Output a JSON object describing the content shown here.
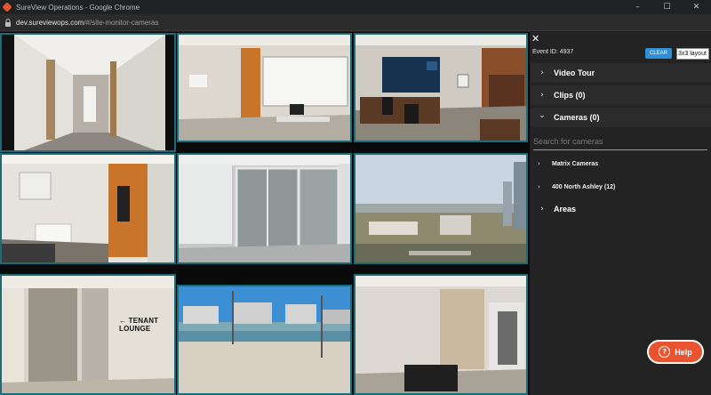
{
  "window": {
    "title": "SureView Operations - Google Chrome",
    "controls": {
      "minimize": "–",
      "maximize": "☐",
      "close": "✕"
    }
  },
  "address": {
    "host": "dev.sureviewops.com",
    "path": "/#/site-monitor-cameras",
    "lock_icon": "lock-icon"
  },
  "cameras": [
    {
      "id": "cam-1",
      "scene": "hallway"
    },
    {
      "id": "cam-2",
      "scene": "office-whiteboard"
    },
    {
      "id": "cam-3",
      "scene": "office-desks"
    },
    {
      "id": "cam-4",
      "scene": "room-with-printer"
    },
    {
      "id": "cam-5",
      "scene": "glass-doors"
    },
    {
      "id": "cam-6",
      "scene": "city-aerial"
    },
    {
      "id": "cam-7",
      "scene": "tenant-lounge",
      "sign": "← TENANT LOUNGE"
    },
    {
      "id": "cam-8",
      "scene": "waterfront"
    },
    {
      "id": "cam-9",
      "scene": "lobby"
    }
  ],
  "panel": {
    "close": "✕",
    "event_id": "Event ID: 4937",
    "clear_label": "CLEAR",
    "layout_value": "3x3 layout",
    "sections": [
      {
        "label": "Video Tour",
        "state": "collapsed"
      },
      {
        "label": "Clips (0)",
        "state": "collapsed"
      },
      {
        "label": "Cameras (0)",
        "state": "expanded"
      }
    ],
    "search_placeholder": "Search for cameras",
    "camera_groups": [
      {
        "label": "Matrix Cameras"
      },
      {
        "label": "400 North Ashley (12)"
      }
    ],
    "areas_label": "Areas",
    "chevron_right": "›",
    "chevron_down": "⌄"
  },
  "help": {
    "label": "Help",
    "icon": "?"
  },
  "colors": {
    "accent": "#2e8fd6",
    "help": "#e8542f",
    "tile_border": "#1d6a78"
  }
}
